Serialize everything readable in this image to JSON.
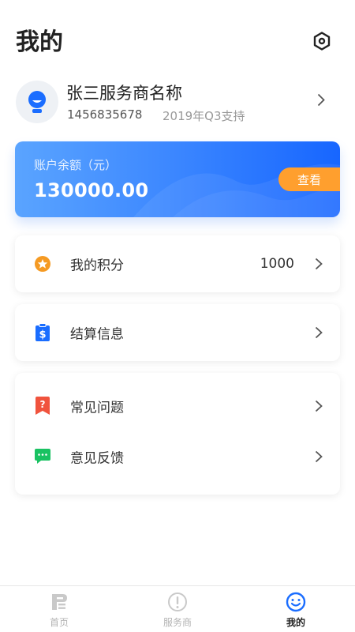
{
  "header": {
    "title": "我的",
    "settings_icon": "settings-hexagon-icon"
  },
  "profile": {
    "avatar_icon": "user-avatar-icon",
    "name": "张三服务商名称",
    "id": "1456835678",
    "plan": "2019年Q3支持"
  },
  "balance": {
    "label": "账户余额（元）",
    "amount": "130000.00",
    "view_button": "查看"
  },
  "menu": {
    "points": {
      "icon": "star-badge-icon",
      "label": "我的积分",
      "value": "1000"
    },
    "settlement": {
      "icon": "dollar-clipboard-icon",
      "label": "结算信息"
    },
    "faq": {
      "icon": "question-bookmark-icon",
      "label": "常见问题"
    },
    "feedback": {
      "icon": "chat-bubble-icon",
      "label": "意见反馈"
    }
  },
  "tabbar": {
    "tabs": [
      {
        "label": "首页",
        "icon": "home-p-icon",
        "active": false
      },
      {
        "label": "服务商",
        "icon": "info-circle-icon",
        "active": false
      },
      {
        "label": "我的",
        "icon": "smiley-icon",
        "active": true
      }
    ]
  },
  "colors": {
    "accent_blue": "#1766ff",
    "orange": "#ff9f2e",
    "tab_inactive": "#b3b3b3"
  }
}
